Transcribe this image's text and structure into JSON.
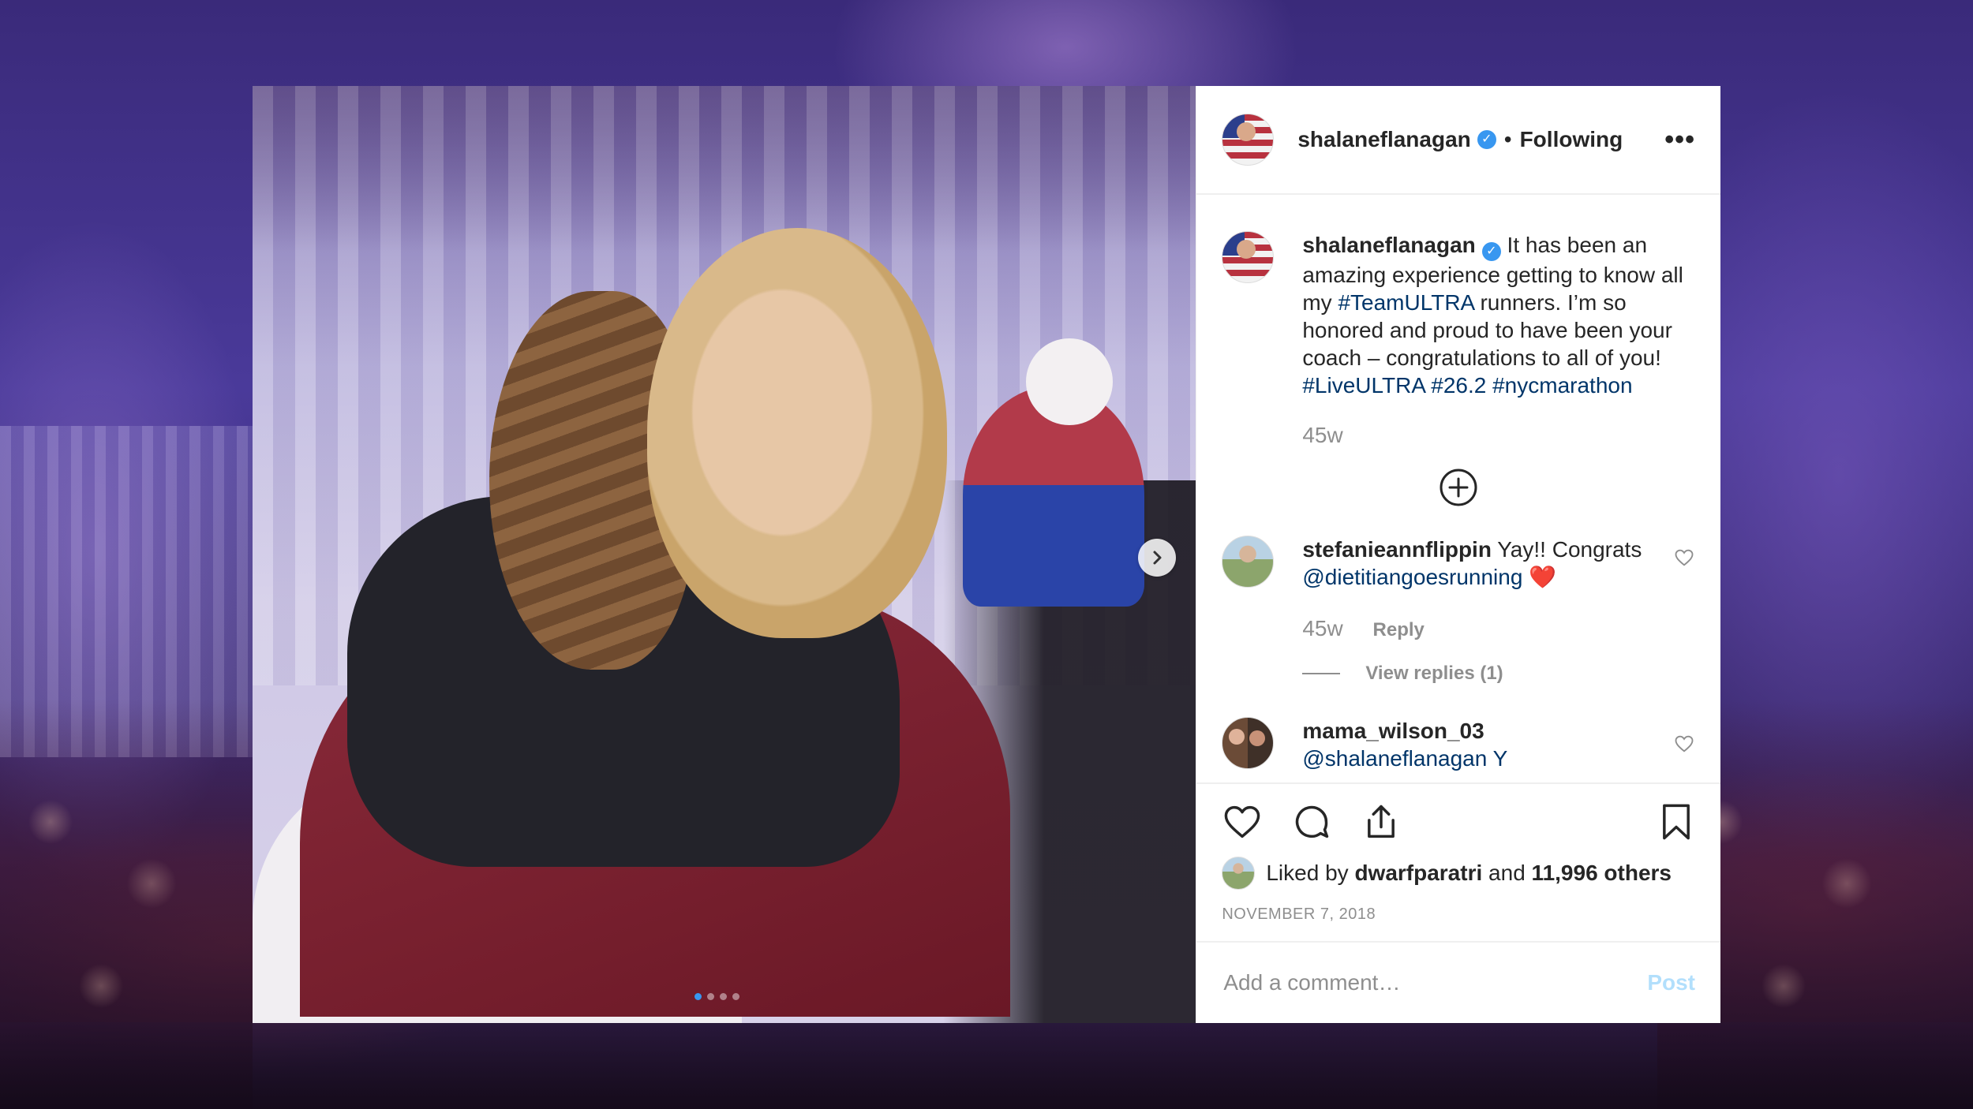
{
  "post": {
    "username": "shalaneflanagan",
    "verified_mark": "✓",
    "bullet": "•",
    "follow_state": "Following",
    "more_icon": "more-options-icon",
    "more_label": "•••",
    "next_icon": "chevron-right-icon",
    "next_label": "›",
    "carousel_count": 4,
    "carousel_active_index": 0
  },
  "caption": {
    "username": "shalaneflanagan",
    "text_1": " It has been an amazing experience getting to know all my ",
    "tag_team": "#TeamULTRA",
    "text_2": " runners. I’m so honored and proud to have been your coach – congratulations to all of you! ",
    "tag_live": "#LiveULTRA",
    "tag_262": "#26.2",
    "tag_nyc": "#nycmarathon",
    "time": "45w"
  },
  "load_more_icon": "plus-circle-icon",
  "comments": [
    {
      "username": "stefanieannflippin",
      "text": " Yay!! Congrats ",
      "mention": "@dietitiangoesrunning",
      "emoji": "❤️",
      "time": "45w",
      "reply_label": "Reply",
      "view_replies": "View replies (1)"
    },
    {
      "username": "mama_wilson_03",
      "text": "@shalaneflanagan Y"
    }
  ],
  "actions": {
    "like_icon": "heart-icon",
    "comment_icon": "comment-icon",
    "share_icon": "share-icon",
    "save_icon": "bookmark-icon"
  },
  "likes": {
    "prefix": "Liked by",
    "user": "dwarfparatri",
    "and": "and",
    "others": "11,996 others"
  },
  "date": "NOVEMBER 7, 2018",
  "add_comment": {
    "placeholder": "Add a comment…",
    "post_label": "Post"
  },
  "colors": {
    "link": "#003569",
    "verified": "#3897f0",
    "muted": "#8e8e8e",
    "post_disabled": "#b2dffc"
  }
}
